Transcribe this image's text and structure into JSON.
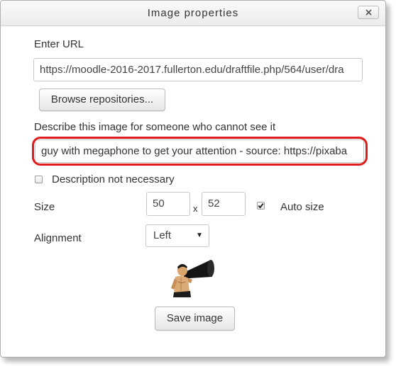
{
  "dialog": {
    "title": "Image properties",
    "close_icon": "close-icon"
  },
  "url": {
    "label": "Enter URL",
    "value": "https://moodle-2016-2017.fullerton.edu/draftfile.php/564/user/dra"
  },
  "browse_button": "Browse repositories...",
  "description": {
    "label": "Describe this image for someone who cannot see it",
    "value": "guy with megaphone to get your attention - source: https://pixaba",
    "highlight_color": "#e01c1c"
  },
  "not_necessary": {
    "label": "Description not necessary",
    "checked": false
  },
  "size": {
    "label": "Size",
    "width": "50",
    "separator": "x",
    "height": "52",
    "auto_label": "Auto size",
    "auto_checked": true
  },
  "alignment": {
    "label": "Alignment",
    "selected": "Left"
  },
  "preview": {
    "icon": "megaphone-man-image"
  },
  "save_button": "Save image"
}
